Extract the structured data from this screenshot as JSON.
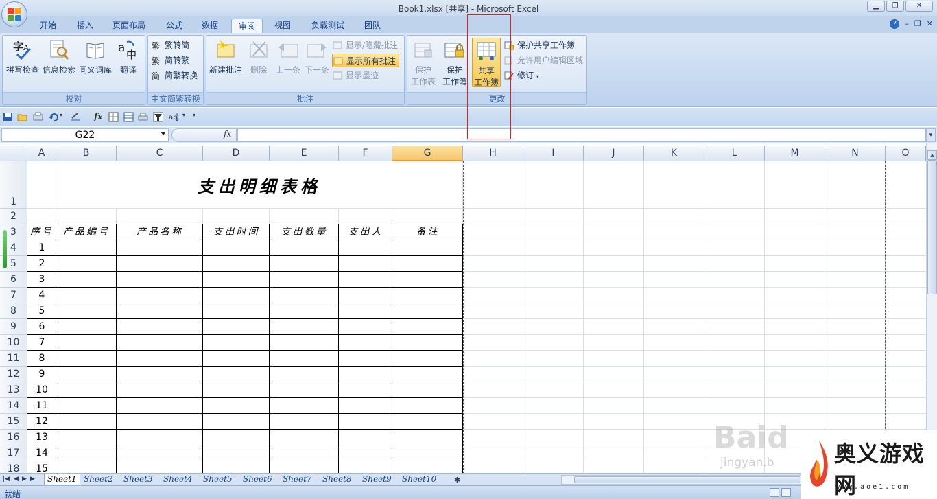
{
  "window": {
    "title": "Book1.xlsx  [共享] - Microsoft Excel"
  },
  "tabs": [
    "开始",
    "插入",
    "页面布局",
    "公式",
    "数据",
    "审阅",
    "视图",
    "负载测试",
    "团队"
  ],
  "active_tab": "审阅",
  "ribbon": {
    "proofing": {
      "label": "校对",
      "buttons": [
        "拼写检查",
        "信息检索",
        "同义词库",
        "翻译"
      ]
    },
    "chinese": {
      "label": "中文简繁转换",
      "buttons": [
        "繁转简",
        "简转繁",
        "简繁转换"
      ]
    },
    "comments": {
      "label": "批注",
      "new": "新建批注",
      "delete": "删除",
      "prev": "上一条",
      "next": "下一条",
      "show_hide": "显示/隐藏批注",
      "show_all": "显示所有批注",
      "show_ink": "显示墨迹"
    },
    "changes": {
      "label": "更改",
      "protect_sheet_1": "保护",
      "protect_sheet_2": "工作表",
      "protect_book_1": "保护",
      "protect_book_2": "工作簿",
      "share_1": "共享",
      "share_2": "工作簿",
      "protect_share": "保护共享工作簿",
      "allow_edit": "允许用户编辑区域",
      "track": "修订"
    }
  },
  "formula_bar": {
    "name_box": "G22",
    "fx": "fx",
    "value": ""
  },
  "columns": [
    "A",
    "B",
    "C",
    "D",
    "E",
    "F",
    "G",
    "H",
    "I",
    "J",
    "K",
    "L",
    "M",
    "N",
    "O"
  ],
  "selected_column": "G",
  "rows": [
    "1",
    "2",
    "3",
    "4",
    "5",
    "6",
    "7",
    "8",
    "9",
    "10",
    "11",
    "12",
    "13",
    "14",
    "15",
    "16",
    "17",
    "18"
  ],
  "sheet": {
    "title": "支出明细表格",
    "headers": [
      "序号",
      "产品编号",
      "产品名称",
      "支出时间",
      "支出数量",
      "支出人",
      "备注"
    ],
    "serials": [
      "1",
      "2",
      "3",
      "4",
      "5",
      "6",
      "7",
      "8",
      "9",
      "10",
      "11",
      "12",
      "13",
      "14",
      "15"
    ]
  },
  "sheet_tabs": [
    "Sheet1",
    "Sheet2",
    "Sheet3",
    "Sheet4",
    "Sheet5",
    "Sheet6",
    "Sheet7",
    "Sheet8",
    "Sheet9",
    "Sheet10"
  ],
  "active_sheet": "Sheet1",
  "status": "就绪",
  "watermark": {
    "baidu": "Baid",
    "jingyan": "jingyan.b",
    "site_name": "奥义游戏网",
    "site_url": "www.aoe1.com"
  },
  "colors": {
    "ribbon_bg": "#c9dbf1",
    "highlight": "#f7c854",
    "annotation_box": "#e02020"
  }
}
